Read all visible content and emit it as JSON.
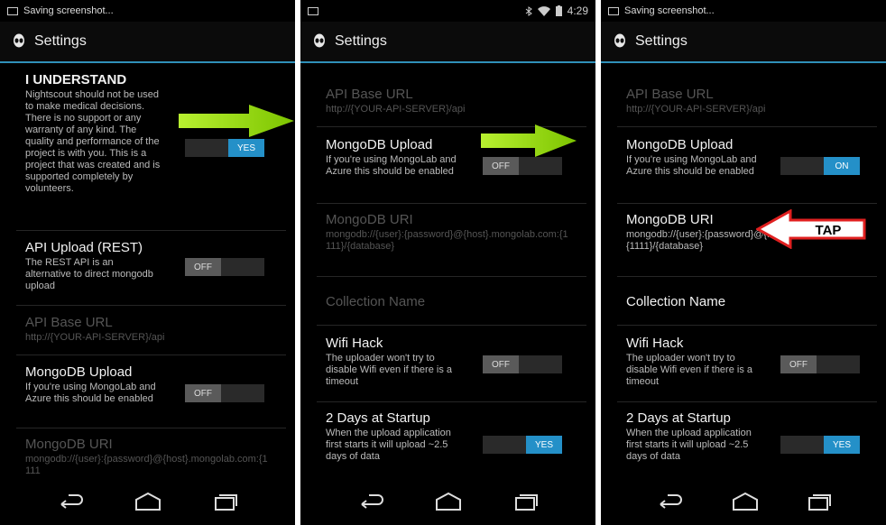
{
  "panels": [
    {
      "status": {
        "text": "Saving screenshot...",
        "time": ""
      },
      "title": "Settings",
      "items": [
        {
          "title": "I UNDERSTAND",
          "summary": "Nightscout should not be used to make medical decisions. There is no support or any warranty of any kind. The quality and performance of the project is with you. This is a project that was created and is supported completely by volunteers.",
          "toggle": "YES"
        },
        {
          "title": "API Upload (REST)",
          "summary": "The REST API is an alternative to direct mongodb upload",
          "toggle": "OFF"
        },
        {
          "title": "API Base URL",
          "summary": "http://{YOUR-API-SERVER}/api"
        },
        {
          "title": "MongoDB Upload",
          "summary": "If you're using MongoLab and Azure this should be enabled",
          "toggle": "OFF"
        },
        {
          "title": "MongoDB URI",
          "summary": "mongodb://{user}:{password}@{host}.mongolab.com:{1111"
        }
      ]
    },
    {
      "status": {
        "text": "",
        "time": "4:29"
      },
      "title": "Settings",
      "items": [
        {
          "title": "API Base URL",
          "summary": "http://{YOUR-API-SERVER}/api"
        },
        {
          "title": "MongoDB Upload",
          "summary": "If you're using MongoLab and Azure this should be enabled",
          "toggle": "OFF"
        },
        {
          "title": "MongoDB URI",
          "summary": "mongodb://{user}:{password}@{host}.mongolab.com:{1111}/{database}"
        },
        {
          "title": "Collection Name",
          "summary": ""
        },
        {
          "title": "Wifi Hack",
          "summary": "The uploader won't try to disable Wifi even if there is a timeout",
          "toggle": "OFF"
        },
        {
          "title": "2 Days at Startup",
          "summary": "When the upload application first starts it will upload ~2.5 days of data",
          "toggle": "YES"
        }
      ]
    },
    {
      "status": {
        "text": "Saving screenshot...",
        "time": ""
      },
      "title": "Settings",
      "items": [
        {
          "title": "API Base URL",
          "summary": "http://{YOUR-API-SERVER}/api"
        },
        {
          "title": "MongoDB Upload",
          "summary": "If you're using MongoLab and Azure this should be enabled",
          "toggle": "ON"
        },
        {
          "title": "MongoDB URI",
          "summary": "mongodb://{user}:{password}@{host}.mongolab.com:{1111}/{database}"
        },
        {
          "title": "Collection Name",
          "summary": ""
        },
        {
          "title": "Wifi Hack",
          "summary": "The uploader won't try to disable Wifi even if there is a timeout",
          "toggle": "OFF"
        },
        {
          "title": "2 Days at Startup",
          "summary": "When the upload application first starts it will upload ~2.5 days of data",
          "toggle": "YES"
        }
      ]
    }
  ],
  "annotations": {
    "tap_label": "TAP"
  },
  "icons": {
    "app": "alien-head-icon",
    "back": "back-icon",
    "home": "home-icon",
    "recents": "recents-icon",
    "wifi": "wifi-icon",
    "battery": "battery-icon"
  },
  "colors": {
    "accent": "#2490c8",
    "arrow_green": "#a6e21c",
    "tap_red": "#e02020"
  }
}
